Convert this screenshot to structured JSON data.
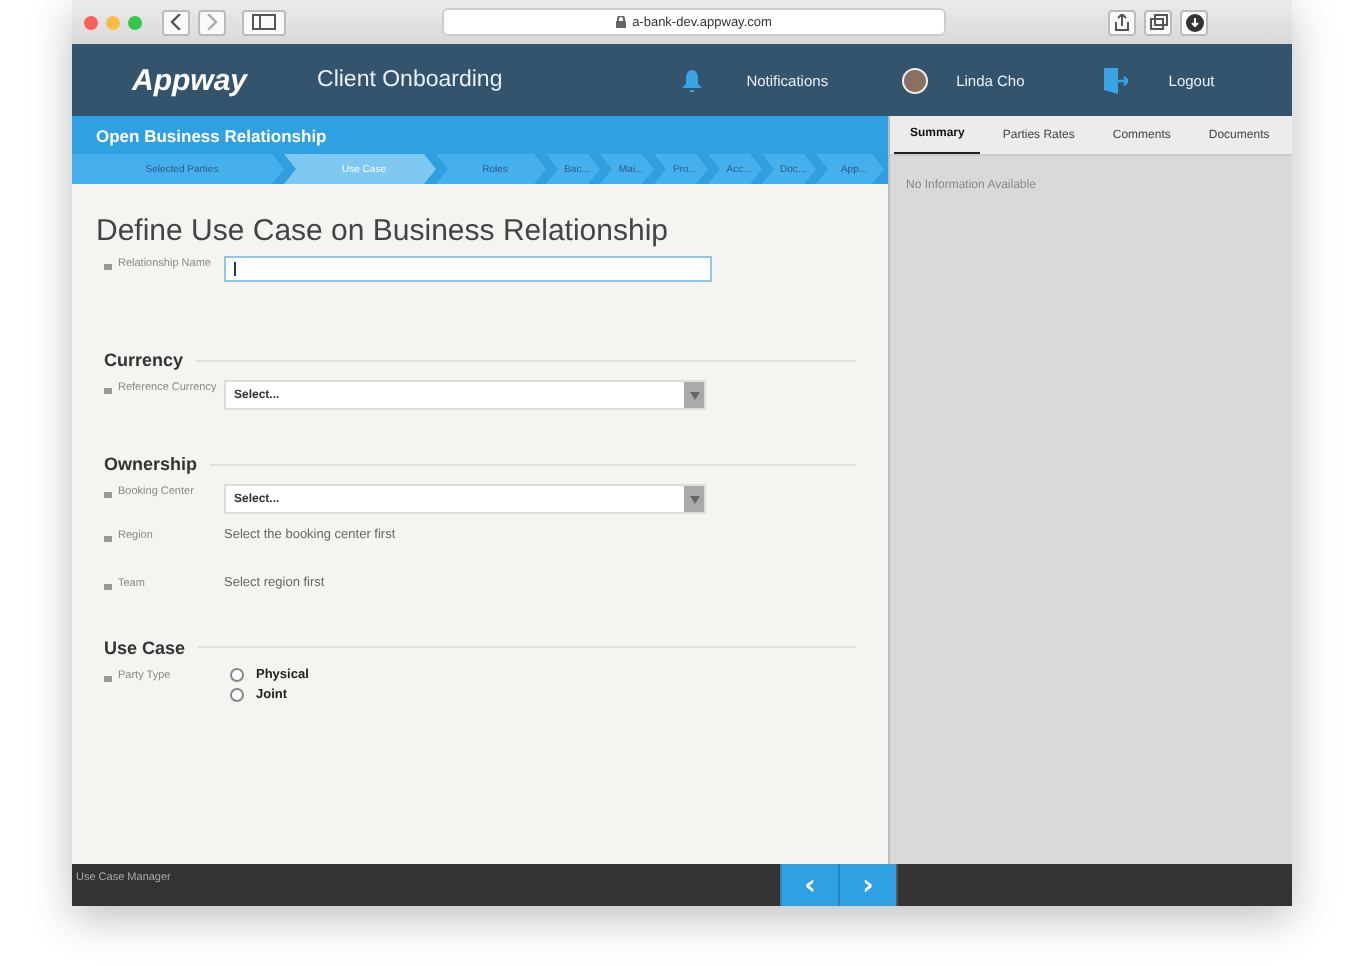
{
  "browser": {
    "url": "a-bank-dev.appway.com"
  },
  "header": {
    "logo": "Appway",
    "app_title": "Client Onboarding",
    "notifications": "Notifications",
    "user": "Linda Cho",
    "logout": "Logout"
  },
  "process": {
    "title": "Open Business Relationship",
    "steps": [
      {
        "label": "Selected Parties",
        "selected": false
      },
      {
        "label": "Use Case",
        "selected": true
      },
      {
        "label": "Roles",
        "selected": false
      },
      {
        "label": "Bac...",
        "selected": false
      },
      {
        "label": "Mai...",
        "selected": false
      },
      {
        "label": "Pro...",
        "selected": false
      },
      {
        "label": "Acc...",
        "selected": false
      },
      {
        "label": "Doc...",
        "selected": false
      },
      {
        "label": "App...",
        "selected": false
      }
    ]
  },
  "form": {
    "title": "Define Use Case on Business Relationship",
    "sections": [
      {
        "fields": [
          {
            "kind": "text",
            "label": "Relationship Name",
            "focused": true
          }
        ]
      },
      {
        "heading": "Currency",
        "fields": [
          {
            "kind": "select",
            "label": "Reference Currency",
            "value": "Select..."
          }
        ]
      },
      {
        "heading": "Ownership",
        "fields": [
          {
            "kind": "select",
            "label": "Booking Center",
            "value": "Select..."
          },
          {
            "kind": "static",
            "label": "Region",
            "value": "Select the booking center first"
          },
          {
            "kind": "static",
            "label": "Team",
            "value": "Select region first"
          }
        ]
      },
      {
        "heading": "Use Case",
        "fields": [
          {
            "kind": "radio",
            "label": "Party Type",
            "options": [
              {
                "label": "Physical",
                "selected": false
              },
              {
                "label": "Joint",
                "selected": false
              }
            ]
          }
        ]
      }
    ]
  },
  "side_panel": {
    "tabs": [
      {
        "label": "Summary",
        "selected": true
      },
      {
        "label": "Parties Rates",
        "selected": false
      },
      {
        "label": "Comments",
        "selected": false
      },
      {
        "label": "Documents",
        "selected": false
      }
    ],
    "message": "No Information Available"
  },
  "footer": {
    "label": "Use Case Manager",
    "prev": "‹",
    "next": "›"
  }
}
